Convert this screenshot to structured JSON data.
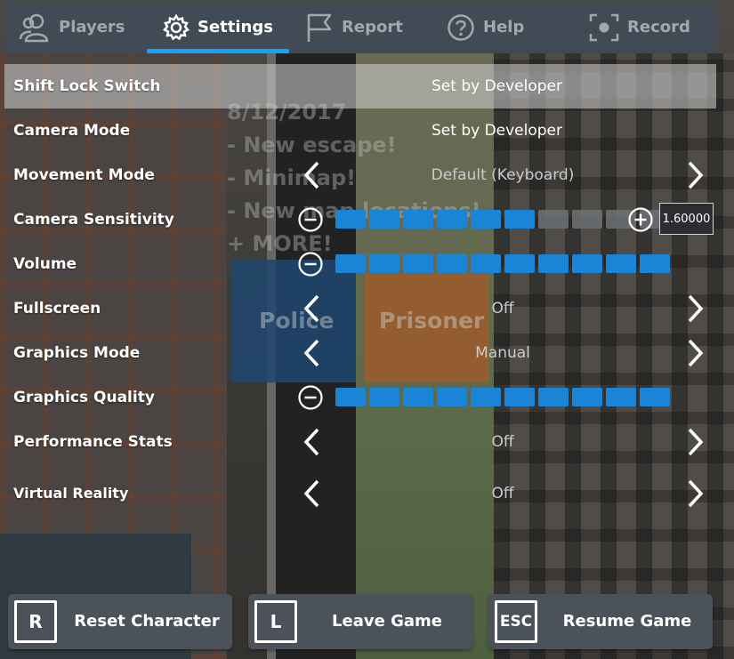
{
  "tabs": [
    {
      "label": "Players",
      "icon": "players-icon"
    },
    {
      "label": "Settings",
      "icon": "gear-icon",
      "active": true
    },
    {
      "label": "Report",
      "icon": "flag-icon"
    },
    {
      "label": "Help",
      "icon": "help-icon"
    },
    {
      "label": "Record",
      "icon": "record-icon"
    }
  ],
  "settings": {
    "shift_lock": {
      "label": "Shift Lock Switch",
      "value": "Set by Developer"
    },
    "camera_mode": {
      "label": "Camera Mode",
      "value": "Set by Developer"
    },
    "movement_mode": {
      "label": "Movement Mode",
      "value": "Default (Keyboard)"
    },
    "camera_sensitivity": {
      "label": "Camera Sensitivity",
      "filled": 6,
      "total": 10,
      "value": "1.60000"
    },
    "volume": {
      "label": "Volume",
      "filled": 10,
      "total": 10
    },
    "fullscreen": {
      "label": "Fullscreen",
      "value": "Off"
    },
    "graphics_mode": {
      "label": "Graphics Mode",
      "value": "Manual"
    },
    "graphics_quality": {
      "label": "Graphics Quality",
      "filled": 10,
      "total": 10
    },
    "performance_stats": {
      "label": "Performance Stats",
      "value": "Off"
    },
    "virtual_reality": {
      "label": "Virtual Reality",
      "value": "Off"
    }
  },
  "scene": {
    "sign_lines": [
      "8/12/2017",
      "- New escape!",
      "- Minimap!",
      "- New map locations!",
      "+ MORE!"
    ],
    "team_police": "Police",
    "team_prisoner": "Prisoner"
  },
  "buttons": {
    "reset": {
      "key": "R",
      "label": "Reset Character"
    },
    "leave": {
      "key": "L",
      "label": "Leave Game"
    },
    "resume": {
      "key": "ESC",
      "label": "Resume Game"
    }
  },
  "colors": {
    "accent": "#13a3ff",
    "slider_fill": "#1a85d6",
    "panel": "#414b55"
  }
}
